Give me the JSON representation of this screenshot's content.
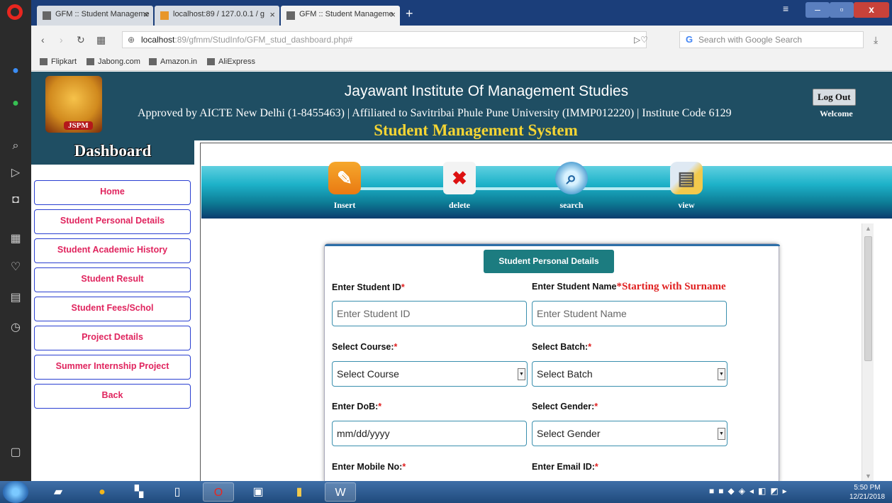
{
  "browser": {
    "tabs": [
      {
        "title": "GFM :: Student Manageme",
        "active": false
      },
      {
        "title": "localhost:89 / 127.0.0.1 / g",
        "active": false
      },
      {
        "title": "GFM :: Student Manageme",
        "active": true
      }
    ],
    "new_tab_symbol": "+",
    "url_host": "localhost",
    "url_rest": ":89/gfmm/StudInfo/GFM_stud_dashboard.php#",
    "search_placeholder": "Search with Google Search",
    "bookmarks": [
      "Flipkart",
      "Jabong.com",
      "Amazon.in",
      "AliExpress"
    ]
  },
  "header": {
    "institute": "Jayawant Institute Of Management Studies",
    "approval": "Approved by AICTE New Delhi (1-8455463) | Affiliated to Savitribai Phule Pune University (IMMP012220) | Institute Code 6129",
    "system_title": "Student Management System",
    "logo_text": "JSPM",
    "logout_label": "Log Out",
    "welcome": "Welcome"
  },
  "sidebar": {
    "title": "Dashboard",
    "items": [
      "Home",
      "Student Personal Details",
      "Student Academic History",
      "Student Result",
      "Student Fees/Schol",
      "Project Details",
      "Summer Internship Project",
      "Back"
    ]
  },
  "toolbar": {
    "insert": "Insert",
    "delete": "delete",
    "search": "search",
    "view": "view"
  },
  "form": {
    "title": "Student Personal Details",
    "student_id_label": "Enter Student ID",
    "student_id_placeholder": "Enter Student ID",
    "student_name_label": "Enter Student Name",
    "student_name_note": "*Starting with Surname",
    "student_name_placeholder": "Enter Student Name",
    "course_label": "Select Course:",
    "course_value": "Select Course",
    "batch_label": "Select Batch:",
    "batch_value": "Select Batch",
    "dob_label": "Enter DoB:",
    "dob_value": "mm/dd/yyyy",
    "gender_label": "Select Gender:",
    "gender_value": "Select Gender",
    "mobile_label": "Enter Mobile No:",
    "email_label": "Enter Email ID:",
    "required_mark": "*"
  },
  "taskbar": {
    "time": "5:50 PM",
    "date": "12/21/2018"
  }
}
